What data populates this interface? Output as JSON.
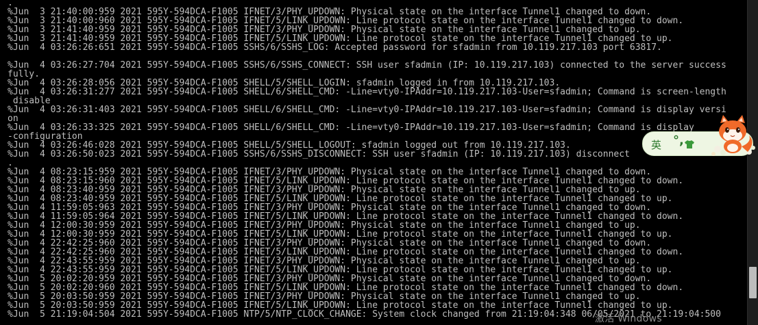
{
  "terminal": {
    "lines": [
      ".",
      "%Jun  3 21:40:00:959 2021 595Y-594DCA-F1005 IFNET/3/PHY_UPDOWN: Physical state on the interface Tunnel1 changed to down.",
      "%Jun  3 21:40:00:960 2021 595Y-594DCA-F1005 IFNET/5/LINK_UPDOWN: Line protocol state on the interface Tunnel1 changed to down.",
      "%Jun  3 21:41:40:959 2021 595Y-594DCA-F1005 IFNET/3/PHY_UPDOWN: Physical state on the interface Tunnel1 changed to up.",
      "%Jun  3 21:41:40:959 2021 595Y-594DCA-F1005 IFNET/5/LINK_UPDOWN: Line protocol state on the interface Tunnel1 changed to up.",
      "%Jun  4 03:26:26:651 2021 595Y-594DCA-F1005 SSHS/6/SSHS_LOG: Accepted password for sfadmin from 10.119.217.103 port 63817.",
      "",
      "%Jun  4 03:26:27:704 2021 595Y-594DCA-F1005 SSHS/6/SSHS_CONNECT: SSH user sfadmin (IP: 10.119.217.103) connected to the server success",
      "fully.",
      "%Jun  4 03:26:28:056 2021 595Y-594DCA-F1005 SHELL/5/SHELL_LOGIN: sfadmin logged in from 10.119.217.103.",
      "%Jun  4 03:26:31:277 2021 595Y-594DCA-F1005 SHELL/6/SHELL_CMD: -Line=vty0-IPAddr=10.119.217.103-User=sfadmin; Command is screen-length",
      " disable",
      "%Jun  4 03:26:31:403 2021 595Y-594DCA-F1005 SHELL/6/SHELL_CMD: -Line=vty0-IPAddr=10.119.217.103-User=sfadmin; Command is display versi",
      "on",
      "%Jun  4 03:26:33:325 2021 595Y-594DCA-F1005 SHELL/6/SHELL_CMD: -Line=vty0-IPAddr=10.119.217.103-User=sfadmin; Command is display",
      "-configuration",
      "%Jun  4 03:26:46:028 2021 595Y-594DCA-F1005 SHELL/5/SHELL_LOGOUT: sfadmin logged out from 10.119.217.103.",
      "%Jun  4 03:26:50:023 2021 595Y-594DCA-F1005 SSHS/6/SSHS_DISCONNECT: SSH user sfadmin (IP: 10.119.217.103) disconnect",
      ".",
      "%Jun  4 08:23:15:959 2021 595Y-594DCA-F1005 IFNET/3/PHY_UPDOWN: Physical state on the interface Tunnel1 changed to down.",
      "%Jun  4 08:23:15:960 2021 595Y-594DCA-F1005 IFNET/5/LINK_UPDOWN: Line protocol state on the interface Tunnel1 changed to down.",
      "%Jun  4 08:23:40:959 2021 595Y-594DCA-F1005 IFNET/3/PHY_UPDOWN: Physical state on the interface Tunnel1 changed to up.",
      "%Jun  4 08:23:40:959 2021 595Y-594DCA-F1005 IFNET/5/LINK_UPDOWN: Line protocol state on the interface Tunnel1 changed to up.",
      "%Jun  4 11:59:05:963 2021 595Y-594DCA-F1005 IFNET/3/PHY_UPDOWN: Physical state on the interface Tunnel1 changed to down.",
      "%Jun  4 11:59:05:964 2021 595Y-594DCA-F1005 IFNET/5/LINK_UPDOWN: Line protocol state on the interface Tunnel1 changed to down.",
      "%Jun  4 12:00:30:959 2021 595Y-594DCA-F1005 IFNET/3/PHY_UPDOWN: Physical state on the interface Tunnel1 changed to up.",
      "%Jun  4 12:00:30:959 2021 595Y-594DCA-F1005 IFNET/5/LINK_UPDOWN: Line protocol state on the interface Tunnel1 changed to up.",
      "%Jun  4 22:42:25:960 2021 595Y-594DCA-F1005 IFNET/3/PHY_UPDOWN: Physical state on the interface Tunnel1 changed to down.",
      "%Jun  4 22:42:25:960 2021 595Y-594DCA-F1005 IFNET/5/LINK_UPDOWN: Line protocol state on the interface Tunnel1 changed to down.",
      "%Jun  4 22:43:55:959 2021 595Y-594DCA-F1005 IFNET/3/PHY_UPDOWN: Physical state on the interface Tunnel1 changed to up.",
      "%Jun  4 22:43:55:959 2021 595Y-594DCA-F1005 IFNET/5/LINK_UPDOWN: Line protocol state on the interface Tunnel1 changed to up.",
      "%Jun  5 20:02:20:959 2021 595Y-594DCA-F1005 IFNET/3/PHY_UPDOWN: Physical state on the interface Tunnel1 changed to down.",
      "%Jun  5 20:02:20:960 2021 595Y-594DCA-F1005 IFNET/5/LINK_UPDOWN: Line protocol state on the interface Tunnel1 changed to down.",
      "%Jun  5 20:03:50:959 2021 595Y-594DCA-F1005 IFNET/3/PHY_UPDOWN: Physical state on the interface Tunnel1 changed to up.",
      "%Jun  5 20:03:50:959 2021 595Y-594DCA-F1005 IFNET/5/LINK_UPDOWN: Line protocol state on the interface Tunnel1 changed to up.",
      "%Jun  5 21:19:04:504 2021 595Y-594DCA-F1005 NTP/5/NTP_CLOCK_CHANGE: System clock changed from 21:19:04:348 06/05/2021 to 21:19:04:500"
    ]
  },
  "ime": {
    "language_label": "英",
    "punctuation_label": "°,",
    "shirt_icon": "shirt-icon",
    "mascot_icon": "fox-mascot-icon",
    "pill_color": "#eef6e3",
    "accent_color": "#2f7a2f"
  },
  "watermark": {
    "text": "激活 Windows"
  },
  "colors": {
    "background": "#000000",
    "text": "#bfbfbf"
  }
}
